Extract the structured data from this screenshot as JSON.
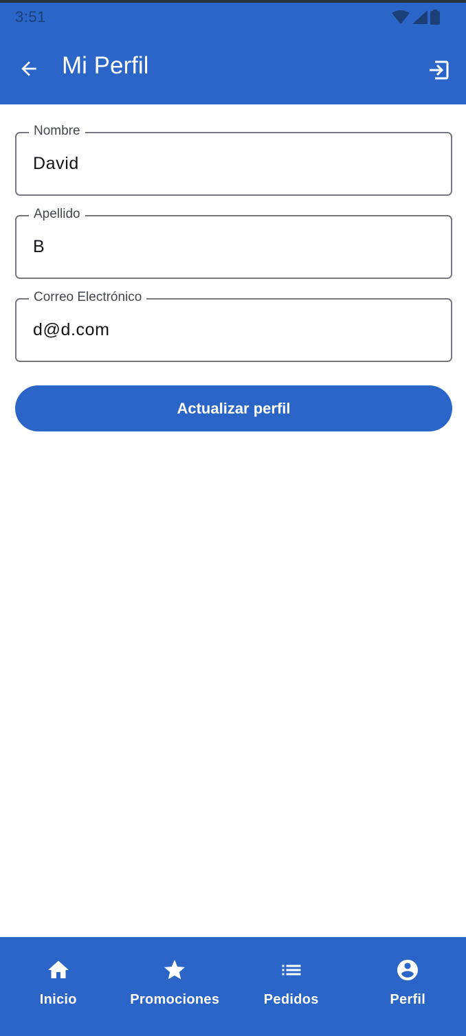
{
  "status_bar": {
    "time": "3:51",
    "icons": [
      "wifi-icon",
      "signal-icon",
      "battery-icon"
    ]
  },
  "app_bar": {
    "title": "Mi Perfil",
    "back_icon": "arrow-back-icon",
    "action_icon": "logout-icon"
  },
  "form": {
    "fields": [
      {
        "label": "Nombre",
        "value": "David"
      },
      {
        "label": "Apellido",
        "value": "B"
      },
      {
        "label": "Correo Electrónico",
        "value": "d@d.com"
      }
    ],
    "submit_label": "Actualizar perfil"
  },
  "bottom_nav": {
    "items": [
      {
        "label": "Inicio",
        "icon": "home-icon"
      },
      {
        "label": "Promociones",
        "icon": "star-icon"
      },
      {
        "label": "Pedidos",
        "icon": "list-icon"
      },
      {
        "label": "Perfil",
        "icon": "account-circle-icon",
        "active": true
      }
    ]
  },
  "colors": {
    "primary": "#2b65c8",
    "on_primary": "#ffffff",
    "outline": "#747780",
    "status_text": "#1d3f78"
  }
}
